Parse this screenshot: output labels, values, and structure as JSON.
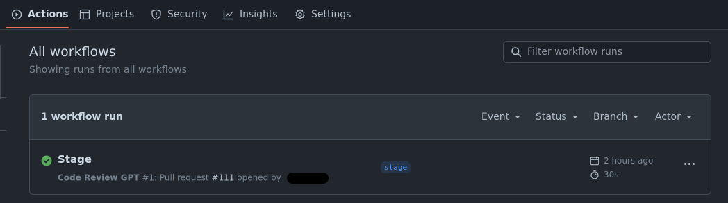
{
  "nav": {
    "tabs": [
      {
        "label": "Actions",
        "icon": "play-circle-icon",
        "active": true
      },
      {
        "label": "Projects",
        "icon": "table-icon",
        "active": false
      },
      {
        "label": "Security",
        "icon": "shield-icon",
        "active": false
      },
      {
        "label": "Insights",
        "icon": "graph-icon",
        "active": false
      },
      {
        "label": "Settings",
        "icon": "gear-icon",
        "active": false
      }
    ],
    "active_underline_color": "#ec775c"
  },
  "header": {
    "title": "All workflows",
    "subtitle": "Showing runs from all workflows"
  },
  "filter": {
    "placeholder": "Filter workflow runs",
    "icon": "search-icon"
  },
  "runs_box": {
    "count_label": "1 workflow run",
    "filters": [
      {
        "label": "Event"
      },
      {
        "label": "Status"
      },
      {
        "label": "Branch"
      },
      {
        "label": "Actor"
      }
    ]
  },
  "runs": [
    {
      "status": "success",
      "status_color": "#57ab5a",
      "title": "Stage",
      "workflow": "Code Review GPT",
      "run_number": "#1",
      "meta_middle": ": Pull request ",
      "pr_link": "#111",
      "meta_tail": " opened by",
      "branch": "stage",
      "time_ago": "2 hours ago",
      "duration": "30s"
    }
  ]
}
